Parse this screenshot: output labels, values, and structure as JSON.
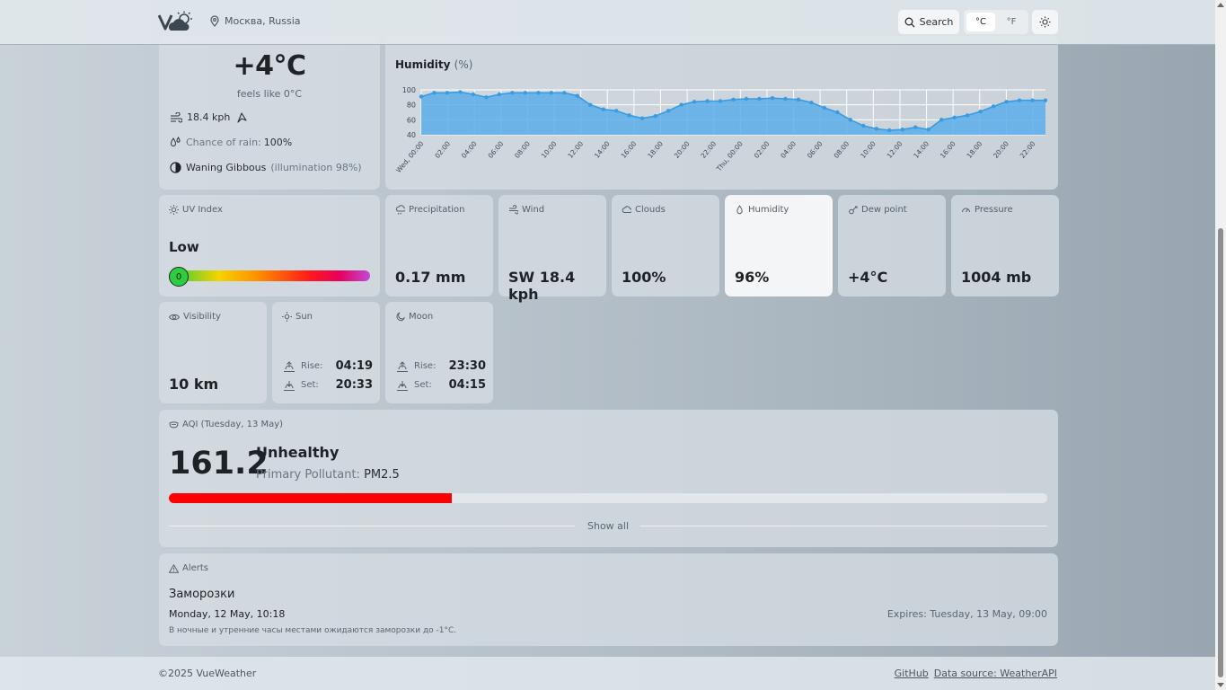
{
  "header": {
    "location": "Москва, Russia",
    "search_label": "Search",
    "unit_c": "°C",
    "unit_f": "°F",
    "theme_icon": "sun-icon"
  },
  "current": {
    "temp": "+4°C",
    "feels_like": "feels like 0°C",
    "wind": "18.4 kph",
    "rain_label": "Chance of rain:",
    "rain_value": "100%",
    "moon_phase": "Waning Gibbous",
    "illumination": "(illumination 98%)"
  },
  "humidity_chart": {
    "title": "Humidity",
    "unit": "(%)"
  },
  "chart_data": {
    "type": "area",
    "title": "Humidity (%)",
    "xlabel": "",
    "ylabel": "",
    "ylim": [
      40,
      100
    ],
    "yticks": [
      40,
      60,
      80,
      100
    ],
    "tick_labels": [
      "Wed, 00:00",
      "02:00",
      "04:00",
      "06:00",
      "08:00",
      "10:00",
      "12:00",
      "14:00",
      "16:00",
      "18:00",
      "20:00",
      "22:00",
      "Thu, 00:00",
      "02:00",
      "04:00",
      "06:00",
      "08:00",
      "10:00",
      "12:00",
      "14:00",
      "16:00",
      "18:00",
      "20:00",
      "22:00"
    ],
    "values": [
      91,
      96,
      96,
      97,
      94,
      90,
      94,
      96,
      96,
      96,
      96,
      96,
      92,
      80,
      74,
      72,
      66,
      62,
      65,
      72,
      80,
      84,
      85,
      85,
      87,
      88,
      88,
      89,
      88,
      87,
      83,
      76,
      70,
      60,
      52,
      48,
      46,
      47,
      50,
      47,
      60,
      63,
      66,
      71,
      78,
      84,
      86,
      86,
      86
    ],
    "color": "#5aaeea"
  },
  "uv": {
    "label": "UV Index",
    "level": "Low",
    "value": "0",
    "fraction": 0
  },
  "tiles": [
    {
      "label": "Precipitation",
      "value": "0.17 mm",
      "icon": "cloud-rain-icon"
    },
    {
      "label": "Wind",
      "value": "SW 18.4 kph",
      "icon": "wind-icon"
    },
    {
      "label": "Clouds",
      "value": "100%",
      "icon": "cloud-icon"
    },
    {
      "label": "Humidity",
      "value": "96%",
      "icon": "droplet-icon"
    },
    {
      "label": "Dew point",
      "value": "+4°C",
      "icon": "thermometer-icon"
    },
    {
      "label": "Pressure",
      "value": "1004 mb",
      "icon": "gauge-icon"
    }
  ],
  "visibility": {
    "label": "Visibility",
    "value": "10 km"
  },
  "sun": {
    "label": "Sun",
    "rise_label": "Rise:",
    "rise": "04:19",
    "set_label": "Set:",
    "set": "20:33"
  },
  "moon": {
    "label": "Moon",
    "rise_label": "Rise:",
    "rise": "23:30",
    "set_label": "Set:",
    "set": "04:15"
  },
  "aqi": {
    "label": "AQI (Tuesday, 13 May)",
    "value": "161.2",
    "status": "Unhealthy",
    "pollutant_label": "Primary Pollutant:",
    "pollutant": "PM2.5",
    "fraction": 0.322,
    "show_all": "Show all"
  },
  "alerts": {
    "label": "Alerts",
    "title": "Заморозки",
    "date": "Monday, 12 May, 10:18",
    "expires": "Expires: Tuesday, 13 May, 09:00",
    "description": "В ночные и утренние часы местами ожидаются заморозки до -1°C."
  },
  "footer": {
    "copyright": "©2025 VueWeather",
    "github": "GitHub",
    "source": "Data source: WeatherAPI"
  }
}
